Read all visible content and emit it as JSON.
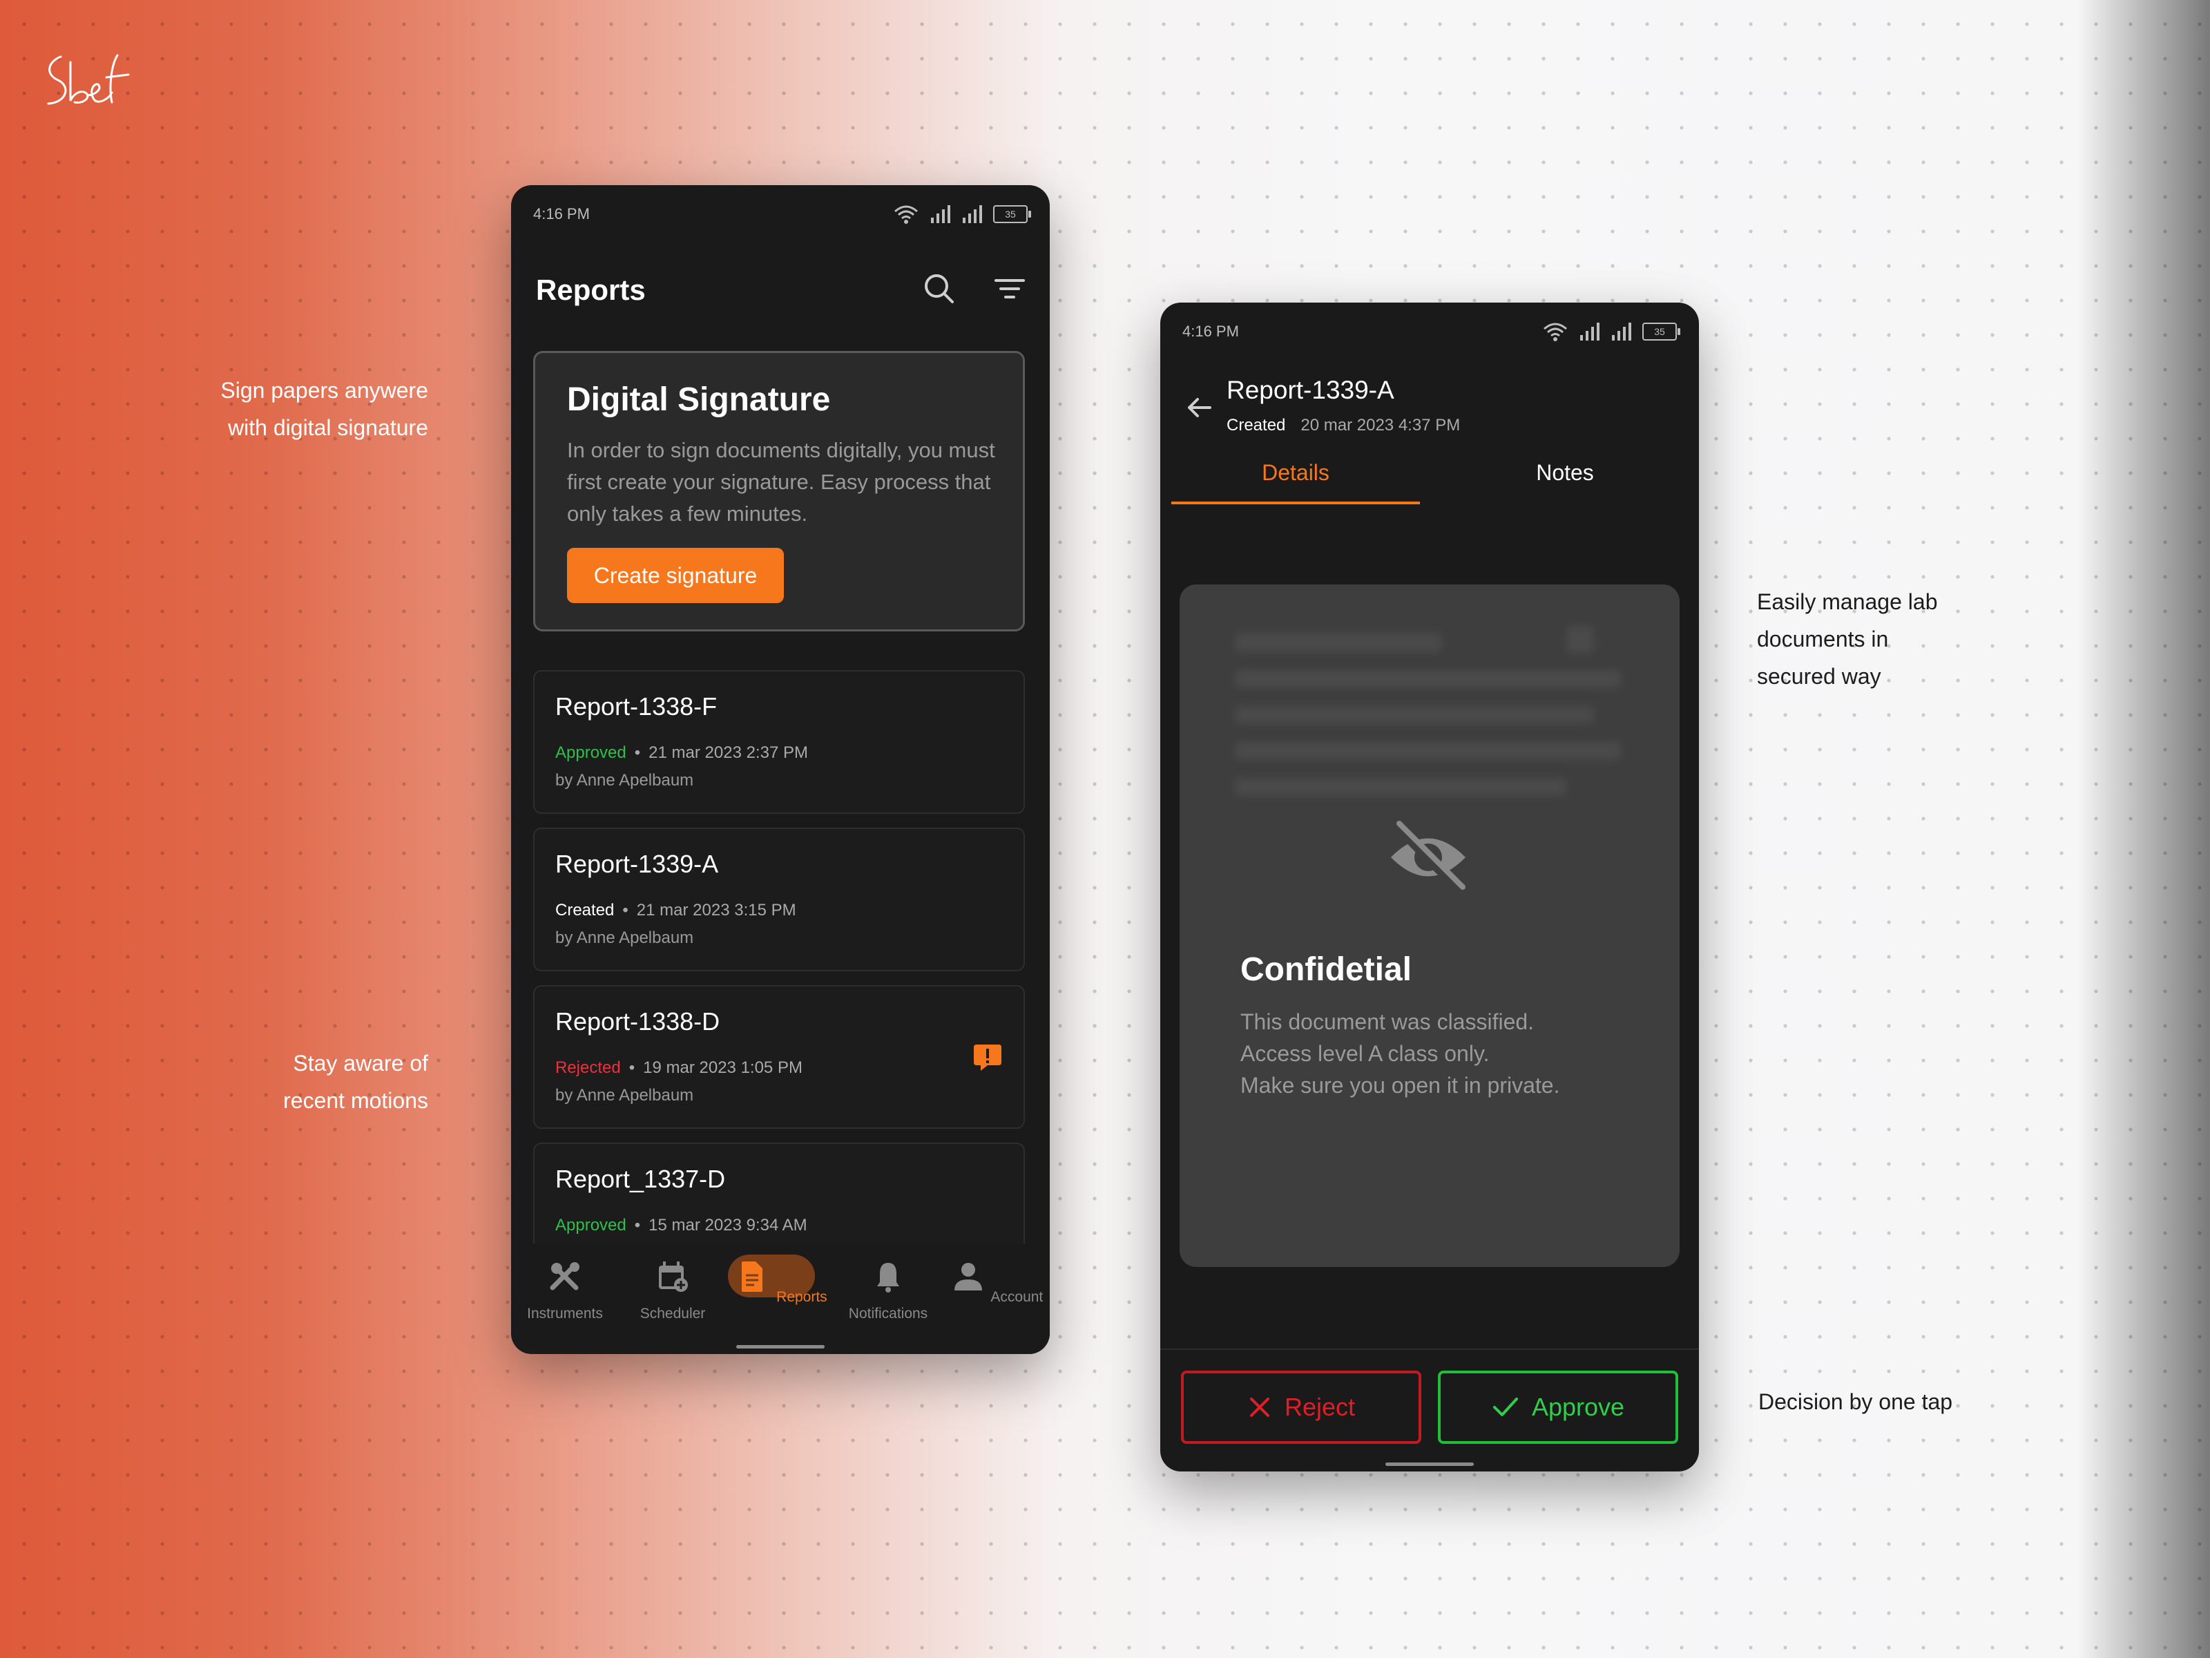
{
  "brand": {
    "logo_text": "Sbef"
  },
  "annotations": {
    "sign": "Sign papers anywere\nwith digital signature",
    "aware": "Stay aware of\nrecent motions",
    "manage": "Easily manage lab\ndocuments in\nsecured way",
    "decision": "Decision by one tap"
  },
  "colors": {
    "accent": "#f7781c",
    "approved": "#2ec04a",
    "rejected": "#f0303c",
    "phone_bg": "#1a1a1a"
  },
  "reports_screen": {
    "status": {
      "time": "4:16 PM",
      "battery": "35"
    },
    "title": "Reports",
    "search_icon": "search-icon",
    "filter_icon": "filter-icon",
    "signature_card": {
      "title": "Digital Signature",
      "text": "In order to sign documents digitally, you must first create your signature. Easy process that only takes a few minutes.",
      "button": "Create signature"
    },
    "reports": [
      {
        "name": "Report-1338-F",
        "status": "Approved",
        "date": "21 mar 2023 2:37 PM",
        "by": "by Anne Apelbaum"
      },
      {
        "name": "Report-1339-A",
        "status": "Created",
        "date": "21 mar 2023 3:15 PM",
        "by": "by Anne Apelbaum"
      },
      {
        "name": "Report-1338-D",
        "status": "Rejected",
        "date": "19 mar 2023 1:05 PM",
        "by": "by Anne Apelbaum",
        "alert_icon": "alert-icon"
      },
      {
        "name": "Report_1337-D",
        "status": "Approved",
        "date": "15 mar 2023 9:34 AM",
        "by": ""
      }
    ],
    "nav": [
      {
        "label": "Instruments",
        "icon": "tools-icon"
      },
      {
        "label": "Scheduler",
        "icon": "calendar-add-icon"
      },
      {
        "label": "Reports",
        "icon": "document-icon",
        "active": true
      },
      {
        "label": "Notifications",
        "icon": "bell-icon"
      },
      {
        "label": "Account",
        "icon": "person-icon"
      }
    ]
  },
  "detail_screen": {
    "status": {
      "time": "4:16 PM",
      "battery": "35"
    },
    "title": "Report-1339-A",
    "status_label": "Created",
    "date": "20 mar 2023 4:37 PM",
    "tabs": [
      "Details",
      "Notes"
    ],
    "active_tab": "Details",
    "confidential": {
      "icon": "eye-off-icon",
      "title": "Confidetial",
      "text": "This document was classified.\nAccess level A class only.\nMake sure you open it in private."
    },
    "reject_label": "Reject",
    "approve_label": "Approve"
  }
}
